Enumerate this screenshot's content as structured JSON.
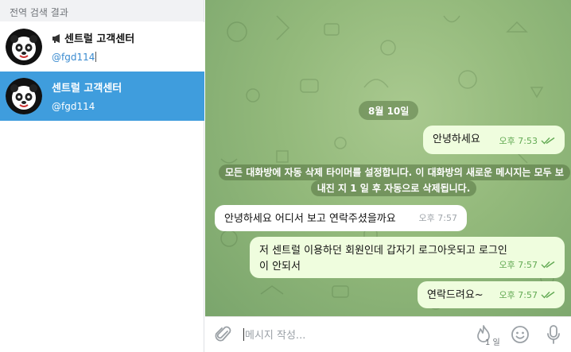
{
  "sidebar": {
    "section_title": "전역 검색 결과",
    "results": [
      {
        "name": "센트럴 고객센터",
        "handle": "@fgd114",
        "is_channel": true,
        "selected": false
      },
      {
        "name": "센트럴 고객센터",
        "handle": "@fgd114",
        "is_channel": false,
        "selected": true
      }
    ]
  },
  "chat": {
    "date": "8월 10일",
    "service_message": "모든 대화방에 자동 삭제 타이머를 설정합니다. 이 대화방의 새로운 메시지는 모두 보내진 지 1 일 후 자동으로 삭제됩니다.",
    "messages": [
      {
        "direction": "out",
        "text": "안녕하세요",
        "time": "오후 7:53",
        "read": true
      },
      {
        "direction": "in",
        "text": "안녕하세요 어디서 보고 연락주셨을까요",
        "time": "오후 7:57"
      },
      {
        "direction": "out",
        "text": "저 센트럴 이용하던 회원인데 갑자기 로그아웃되고 로그인이 안되서",
        "time": "오후 7:57",
        "read": true
      },
      {
        "direction": "out",
        "text": "연락드려요~",
        "time": "오후 7:57",
        "read": true
      }
    ]
  },
  "composer": {
    "placeholder": "메시지 작성...",
    "timer_label": "1 일"
  },
  "colors": {
    "selected_row": "#3f9ddd",
    "outgoing_bubble": "#effdde",
    "incoming_bubble": "#ffffff",
    "handle_link": "#3a8bd0",
    "check_green": "#63aa54"
  },
  "icons": [
    "megaphone-icon",
    "avatar-panda",
    "double-check-icon",
    "paperclip-icon",
    "fire-timer-icon",
    "emoji-icon",
    "microphone-icon"
  ]
}
